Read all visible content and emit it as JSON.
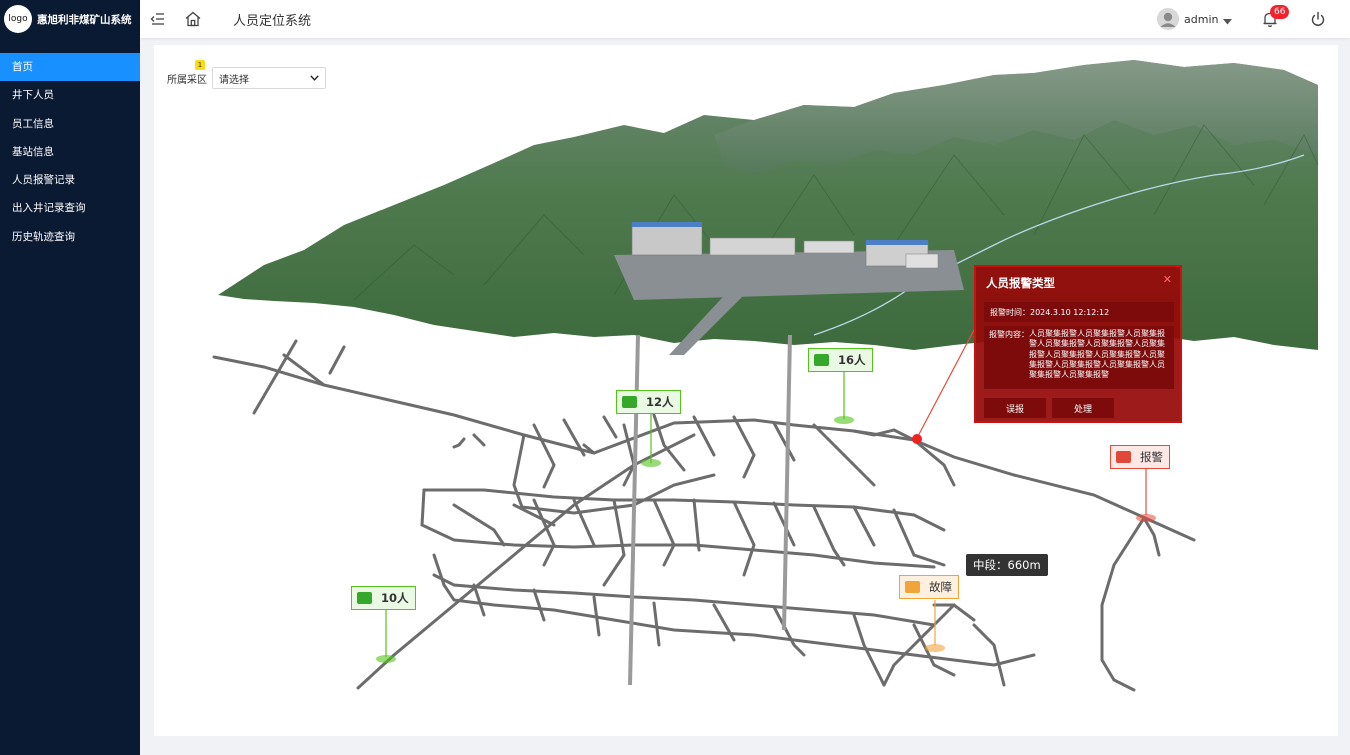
{
  "brand": {
    "logo_text": "logo",
    "name": "惠旭利非煤矿山系统"
  },
  "sidebar": {
    "items": [
      {
        "label": "首页",
        "active": true
      },
      {
        "label": "井下人员"
      },
      {
        "label": "员工信息"
      },
      {
        "label": "基站信息"
      },
      {
        "label": "人员报警记录"
      },
      {
        "label": "出入井记录查询"
      },
      {
        "label": "历史轨迹查询"
      }
    ]
  },
  "header": {
    "title": "人员定位系统",
    "username": "admin",
    "notification_count": "66"
  },
  "filter": {
    "label": "所属采区",
    "count": "1",
    "selected": "请选择"
  },
  "map": {
    "tags": [
      {
        "text": "12人",
        "status": "normal"
      },
      {
        "text": "16人",
        "status": "normal"
      },
      {
        "text": "10人",
        "status": "normal"
      },
      {
        "text": "报警",
        "status": "alarm"
      },
      {
        "text": "故障",
        "status": "fault"
      }
    ],
    "distance_tip": "中段：660m"
  },
  "alarm_panel": {
    "title": "人员报警类型",
    "time_label": "报警时间：",
    "time_value": "2024.3.10 12:12:12",
    "content_label": "报警内容：",
    "content_value": "人员聚集报警人员聚集报警人员聚集报警人员聚集报警人员聚集报警人员聚集报警人员聚集报警人员聚集报警人员聚集报警人员聚集报警人员聚集报警人员聚集报警人员聚集报警",
    "false_alarm_label": "误报",
    "handle_label": "处理"
  },
  "colors": {
    "sidebar_bg": "#0b1a33",
    "menu_active": "#1890ff",
    "alarm_red": "#b01515",
    "normal_green": "#52c41a",
    "fault_orange": "#f0a43a"
  }
}
